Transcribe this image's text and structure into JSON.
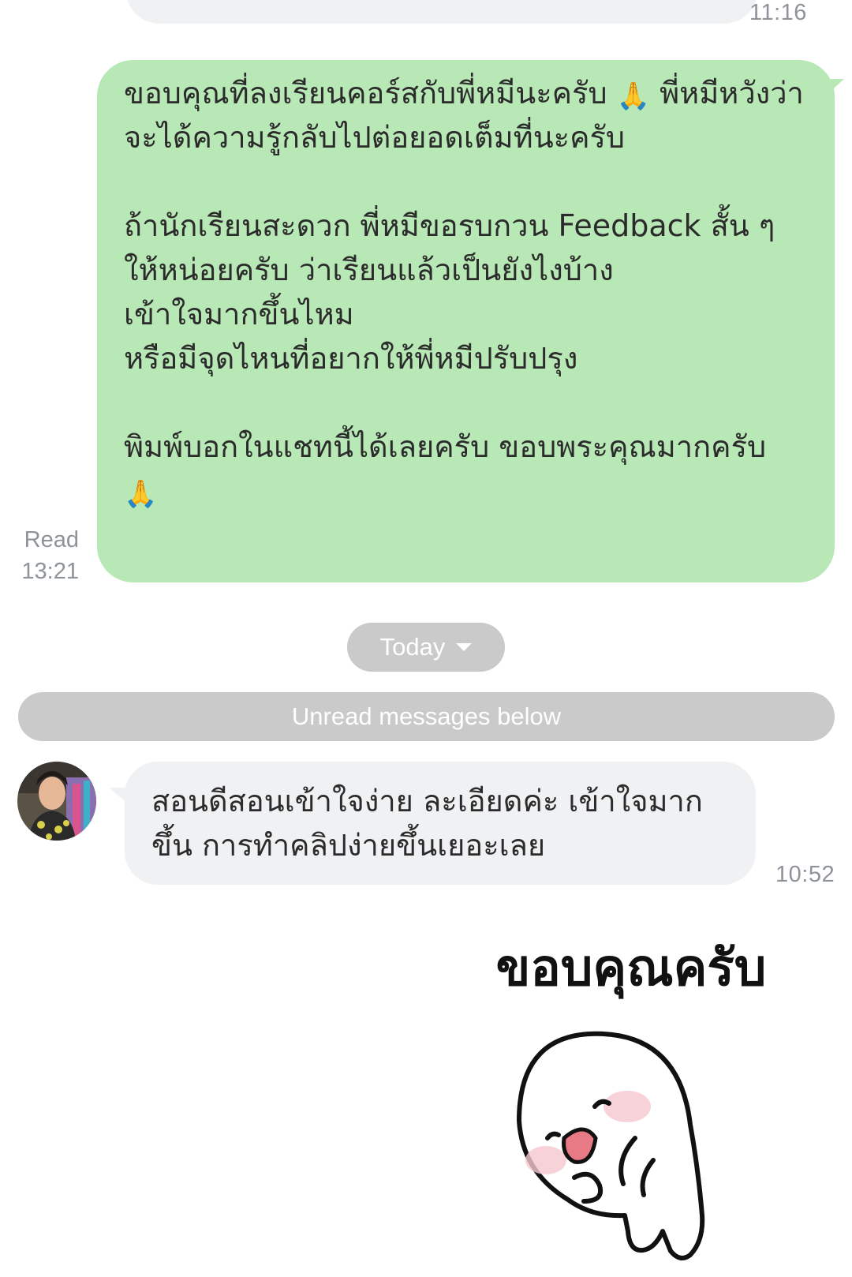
{
  "chat": {
    "top_message_time": "11:16",
    "outgoing": {
      "text_line1": "ขอบคุณที่ลงเรียนคอร์สกับพี่หมีนะครับ",
      "text_line2": "พี่หมีหวังว่า จะได้ความรู้กลับไปต่อยอดเต็มที่นะครับ",
      "text_para2": "ถ้านักเรียนสะดวก พี่หมีขอรบกวน Feedback สั้น ๆ ให้หน่อยครับ ว่าเรียนแล้วเป็นยังไงบ้าง\nเข้าใจมากขึ้นไหม\nหรือมีจุดไหนที่อยากให้พี่หมีปรับปรุง",
      "text_para3": "พิมพ์บอกในแชทนี้ได้เลยครับ ขอบพระคุณมากครับ",
      "emoji": "🙏",
      "read_label": "Read",
      "time": "13:21"
    },
    "date_pill": "Today",
    "unread_banner": "Unread messages below",
    "incoming": {
      "text": "สอนดีสอนเข้าใจง่าย ละเอียดค่ะ เข้าใจมากขึ้น การทำคลิปง่ายขึ้นเยอะเลย",
      "time": "10:52"
    },
    "sticker": {
      "text": "ขอบคุณครับ"
    }
  },
  "colors": {
    "outgoing_bubble": "#b8e8b5",
    "incoming_bubble": "#f0f1f3",
    "pill_gray": "#cacaca",
    "timestamp_gray": "#8e9399"
  }
}
